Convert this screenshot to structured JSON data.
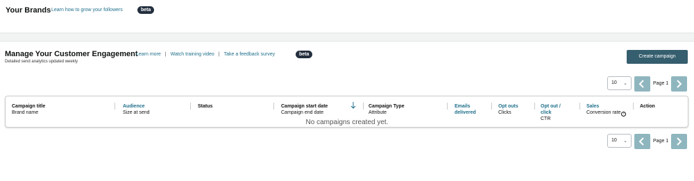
{
  "brands": {
    "title": "Your Brands",
    "link": "Learn how to grow your followers",
    "badge": "beta"
  },
  "engagement": {
    "title": "Manage Your Customer Engagement",
    "subtitle": "Detailed send analytics updated weekly",
    "links": [
      "Learn more",
      "Watch training video",
      "Take a feedback survey"
    ],
    "separator": "|",
    "badge": "beta",
    "create_button": "Create campaign"
  },
  "pagination": {
    "page_size": "10",
    "page_label": "Page 1"
  },
  "table": {
    "columns": [
      {
        "header": "Campaign title",
        "sub": "Brand name"
      },
      {
        "header": "Audience",
        "sub": "Size at send"
      },
      {
        "header": "Status",
        "sub": ""
      },
      {
        "header": "Campaign start date",
        "sub": "Campaign end date"
      },
      {
        "header": "Campaign Type",
        "sub": "Attribute"
      },
      {
        "header": "Emails",
        "header2": "delivered",
        "sub": ""
      },
      {
        "header": "Opt outs",
        "sub": "Clicks"
      },
      {
        "header": "Opt out /",
        "header2": "click",
        "sub": "CTR"
      },
      {
        "header": "Sales",
        "sub": "Conversion rate"
      },
      {
        "header": "Action",
        "sub": ""
      }
    ]
  },
  "empty_message": "No campaigns created yet.",
  "colors": {
    "link": "#1f6f8b",
    "primary_button": "#355e6e",
    "pager_button": "#8fb6bf",
    "badge": "#232f3e"
  },
  "icons": {
    "sort": "arrow-down-icon",
    "info": "info-circle-icon",
    "prev": "chevron-left-icon",
    "next": "chevron-right-icon",
    "dropdown": "chevron-down-icon"
  }
}
